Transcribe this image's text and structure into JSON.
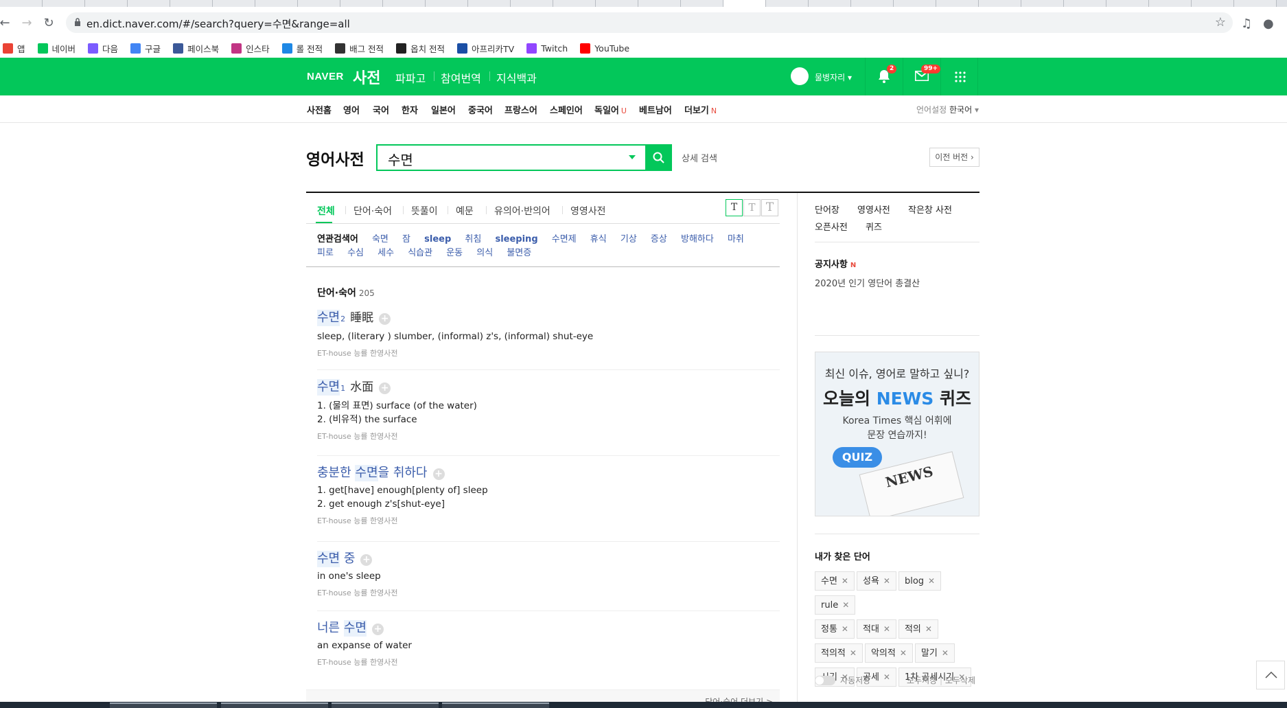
{
  "browser": {
    "url": "en.dict.naver.com/#/search?query=수면&range=all",
    "bookmarks": [
      {
        "label": "앱",
        "icon": "apps-grid-icon",
        "color": "#ea4335"
      },
      {
        "label": "네이버",
        "icon": "naver-n-icon",
        "color": "#03c75a"
      },
      {
        "label": "다음",
        "icon": "daum-icon",
        "color": "#7b5cff"
      },
      {
        "label": "구글",
        "icon": "google-g-icon",
        "color": "#4285f4"
      },
      {
        "label": "페이스북",
        "icon": "facebook-icon",
        "color": "#3b5998"
      },
      {
        "label": "인스타",
        "icon": "instagram-icon",
        "color": "#c13584"
      },
      {
        "label": "롤 전적",
        "icon": "opgg-icon",
        "color": "#1e88e5"
      },
      {
        "label": "배그 전적",
        "icon": "pubg-icon",
        "color": "#333333"
      },
      {
        "label": "옵치 전적",
        "icon": "overwatch-icon",
        "color": "#222222"
      },
      {
        "label": "아프리카TV",
        "icon": "afreeca-icon",
        "color": "#1b4fa5"
      },
      {
        "label": "Twitch",
        "icon": "twitch-icon",
        "color": "#9146ff"
      },
      {
        "label": "YouTube",
        "icon": "youtube-icon",
        "color": "#ff0000"
      }
    ]
  },
  "header": {
    "logo": "NAVER",
    "service": "사전",
    "links": [
      "파파고",
      "참여번역",
      "지식백과"
    ],
    "user": "물병자리",
    "notif_count": "2",
    "mail_count": "99+"
  },
  "lnb": {
    "items": [
      {
        "label": "사전홈",
        "mark": ""
      },
      {
        "label": "영어",
        "mark": ""
      },
      {
        "label": "국어",
        "mark": ""
      },
      {
        "label": "한자",
        "mark": ""
      },
      {
        "label": "일본어",
        "mark": ""
      },
      {
        "label": "중국어",
        "mark": ""
      },
      {
        "label": "프랑스어",
        "mark": ""
      },
      {
        "label": "스페인어",
        "mark": ""
      },
      {
        "label": "독일어",
        "mark": "U"
      },
      {
        "label": "베트남어",
        "mark": ""
      },
      {
        "label": "더보기",
        "mark": "N"
      }
    ],
    "lang_label": "언어설정",
    "lang_value": "한국어"
  },
  "search": {
    "title": "영어사전",
    "query": "수면",
    "detail": "상세 검색",
    "prev_version": "이전 버전"
  },
  "filter_tabs": [
    "전체",
    "단어·숙어",
    "뜻풀이",
    "예문",
    "유의어·반의어",
    "영영사전"
  ],
  "font_sizes": [
    "T",
    "T",
    "T"
  ],
  "related": {
    "title": "연관검색어",
    "words": [
      {
        "w": "숙면",
        "en": false
      },
      {
        "w": "잠",
        "en": false
      },
      {
        "w": "sleep",
        "en": true
      },
      {
        "w": "취침",
        "en": false
      },
      {
        "w": "sleeping",
        "en": true
      },
      {
        "w": "수면제",
        "en": false
      },
      {
        "w": "휴식",
        "en": false
      },
      {
        "w": "기상",
        "en": false
      },
      {
        "w": "증상",
        "en": false
      },
      {
        "w": "방해하다",
        "en": false
      },
      {
        "w": "마취",
        "en": false
      },
      {
        "w": "피로",
        "en": false
      },
      {
        "w": "수심",
        "en": false
      },
      {
        "w": "세수",
        "en": false
      },
      {
        "w": "식습관",
        "en": false
      },
      {
        "w": "운동",
        "en": false
      },
      {
        "w": "의식",
        "en": false
      },
      {
        "w": "불면증",
        "en": false
      }
    ]
  },
  "results": {
    "section_title": "단어·숙어",
    "count": "205",
    "entries": [
      {
        "pre": "",
        "hl": "수면",
        "post": "",
        "sup": "2",
        "hanja": "睡眠",
        "means": [
          "sleep, (literary ) slumber, (informal) z's, (informal) shut-eye"
        ],
        "src": "ET-house 능률 한영사전"
      },
      {
        "pre": "",
        "hl": "수면",
        "post": "",
        "sup": "1",
        "hanja": "水面",
        "means": [
          "1. (물의 표면) surface (of the water)",
          "2. (비유적) the surface"
        ],
        "src": "ET-house 능률 한영사전"
      },
      {
        "pre": "충분한 ",
        "hl": "수면",
        "post": "을 취하다",
        "sup": "",
        "hanja": "",
        "means": [
          "1. get[have] enough[plenty of] sleep",
          "2. get enough z's[shut-eye]"
        ],
        "src": "ET-house 능률 한영사전"
      },
      {
        "pre": "",
        "hl": "수면",
        "post": " 중",
        "sup": "",
        "hanja": "",
        "means": [
          "in one's sleep"
        ],
        "src": "ET-house 능률 한영사전"
      },
      {
        "pre": "너른 ",
        "hl": "수면",
        "post": "",
        "sup": "",
        "hanja": "",
        "means": [
          "an expanse of water"
        ],
        "src": "ET-house 능률 한영사전"
      }
    ],
    "more": "단어·숙어 더보기 >"
  },
  "sidebar": {
    "links": [
      "단어장",
      "영영사전",
      "작은창 사전",
      "오픈사전",
      "퀴즈"
    ],
    "notice_title": "공지사항",
    "notice_mark": "N",
    "notice_item": "2020년 인기 영단어 총결산",
    "ad": {
      "line1": "최신 이슈, 영어로 말하고 싶니?",
      "line2a": "오늘의 ",
      "line2b": "NEWS",
      "line2c": " 퀴즈",
      "line3a": "Korea Times 핵심 어휘에",
      "line3b": "문장 연습까지!",
      "badge": "QUIZ",
      "paper": "NEWS"
    },
    "my_words_title": "내가 찾은 단어",
    "my_words": [
      "수면",
      "성욕",
      "blog",
      "rule",
      "정통",
      "적대",
      "적의",
      "적의적",
      "악의적",
      "말기",
      "시기",
      "공세",
      "1차 공세시기"
    ],
    "auto_save": "자동저장",
    "save_all": "모두저장",
    "delete_all": "모두삭제"
  },
  "colors": {
    "brand": "#03c75a",
    "link": "#3b5dab",
    "badge": "#ff3b30"
  }
}
